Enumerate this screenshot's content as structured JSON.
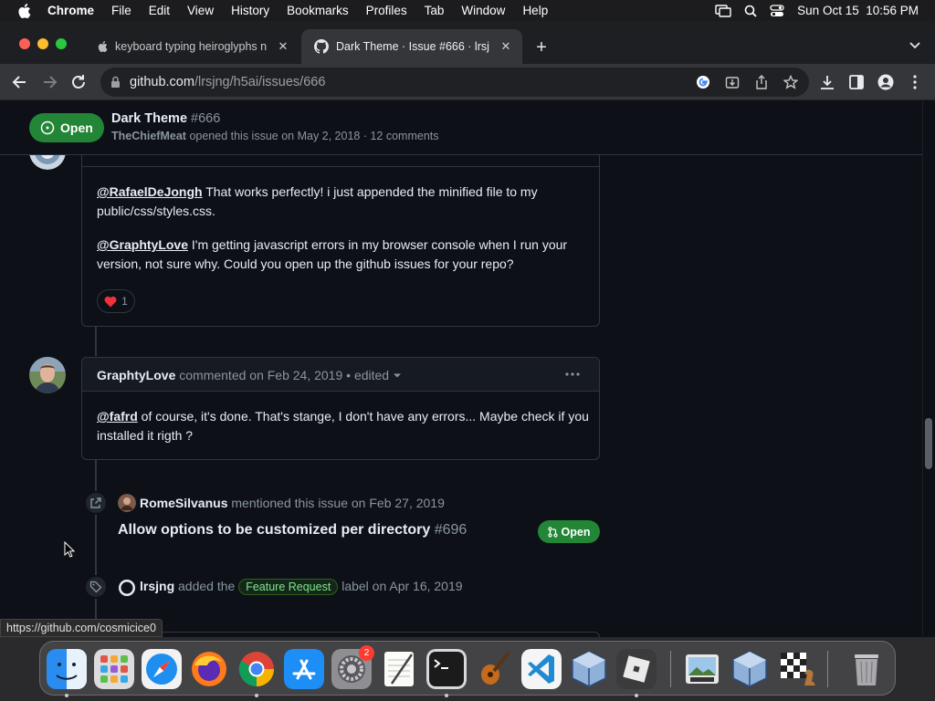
{
  "menubar": {
    "app": "Chrome",
    "items": [
      "File",
      "Edit",
      "View",
      "History",
      "Bookmarks",
      "Profiles",
      "Tab",
      "Window",
      "Help"
    ],
    "datetime": "Sun Oct 15  10:56 PM"
  },
  "tabs": [
    {
      "title": "keyboard typing heiroglyphs n",
      "active": false
    },
    {
      "title": "Dark Theme · Issue #666 · lrsj",
      "active": true
    }
  ],
  "omnibox": {
    "domain": "github.com",
    "path": "/lrsjng/h5ai/issues/666"
  },
  "issue": {
    "state": "Open",
    "title": "Dark Theme",
    "number": "#666",
    "author": "TheChiefMeat",
    "meta": "opened this issue on May 2, 2018 · 12 comments"
  },
  "comment1": {
    "p1_mention": "@RafaelDeJongh",
    "p1_text": " That works perfectly! i just appended the minified file to my public/css/styles.css.",
    "p2_mention": "@GraphtyLove",
    "p2_text": " I'm getting javascript errors in my browser console when I run your version, not sure why. Could you open up the github issues for your repo?",
    "reaction_count": "1"
  },
  "comment2": {
    "author": "GraphtyLove",
    "meta": "commented on Feb 24, 2019",
    "edited": "• edited",
    "mention": "@fafrd",
    "text": " of course, it's done. That's stange, I don't have any errors... Maybe check if you installed it rigth ?"
  },
  "mention_event": {
    "user": "RomeSilvanus",
    "text": "mentioned this issue on Feb 27, 2019",
    "ref_title": "Allow options to be customized per directory",
    "ref_number": "#696",
    "ref_state": "Open"
  },
  "label_event": {
    "user": "lrsjng",
    "text_before": "added the",
    "label": "Feature Request",
    "text_after": "label on Apr 16, 2019"
  },
  "status_url": "https://github.com/cosmicice0",
  "dock": {
    "settings_badge": "2"
  },
  "colors": {
    "accent_green": "#238636",
    "bg": "#0d1117",
    "border": "#30363d"
  }
}
